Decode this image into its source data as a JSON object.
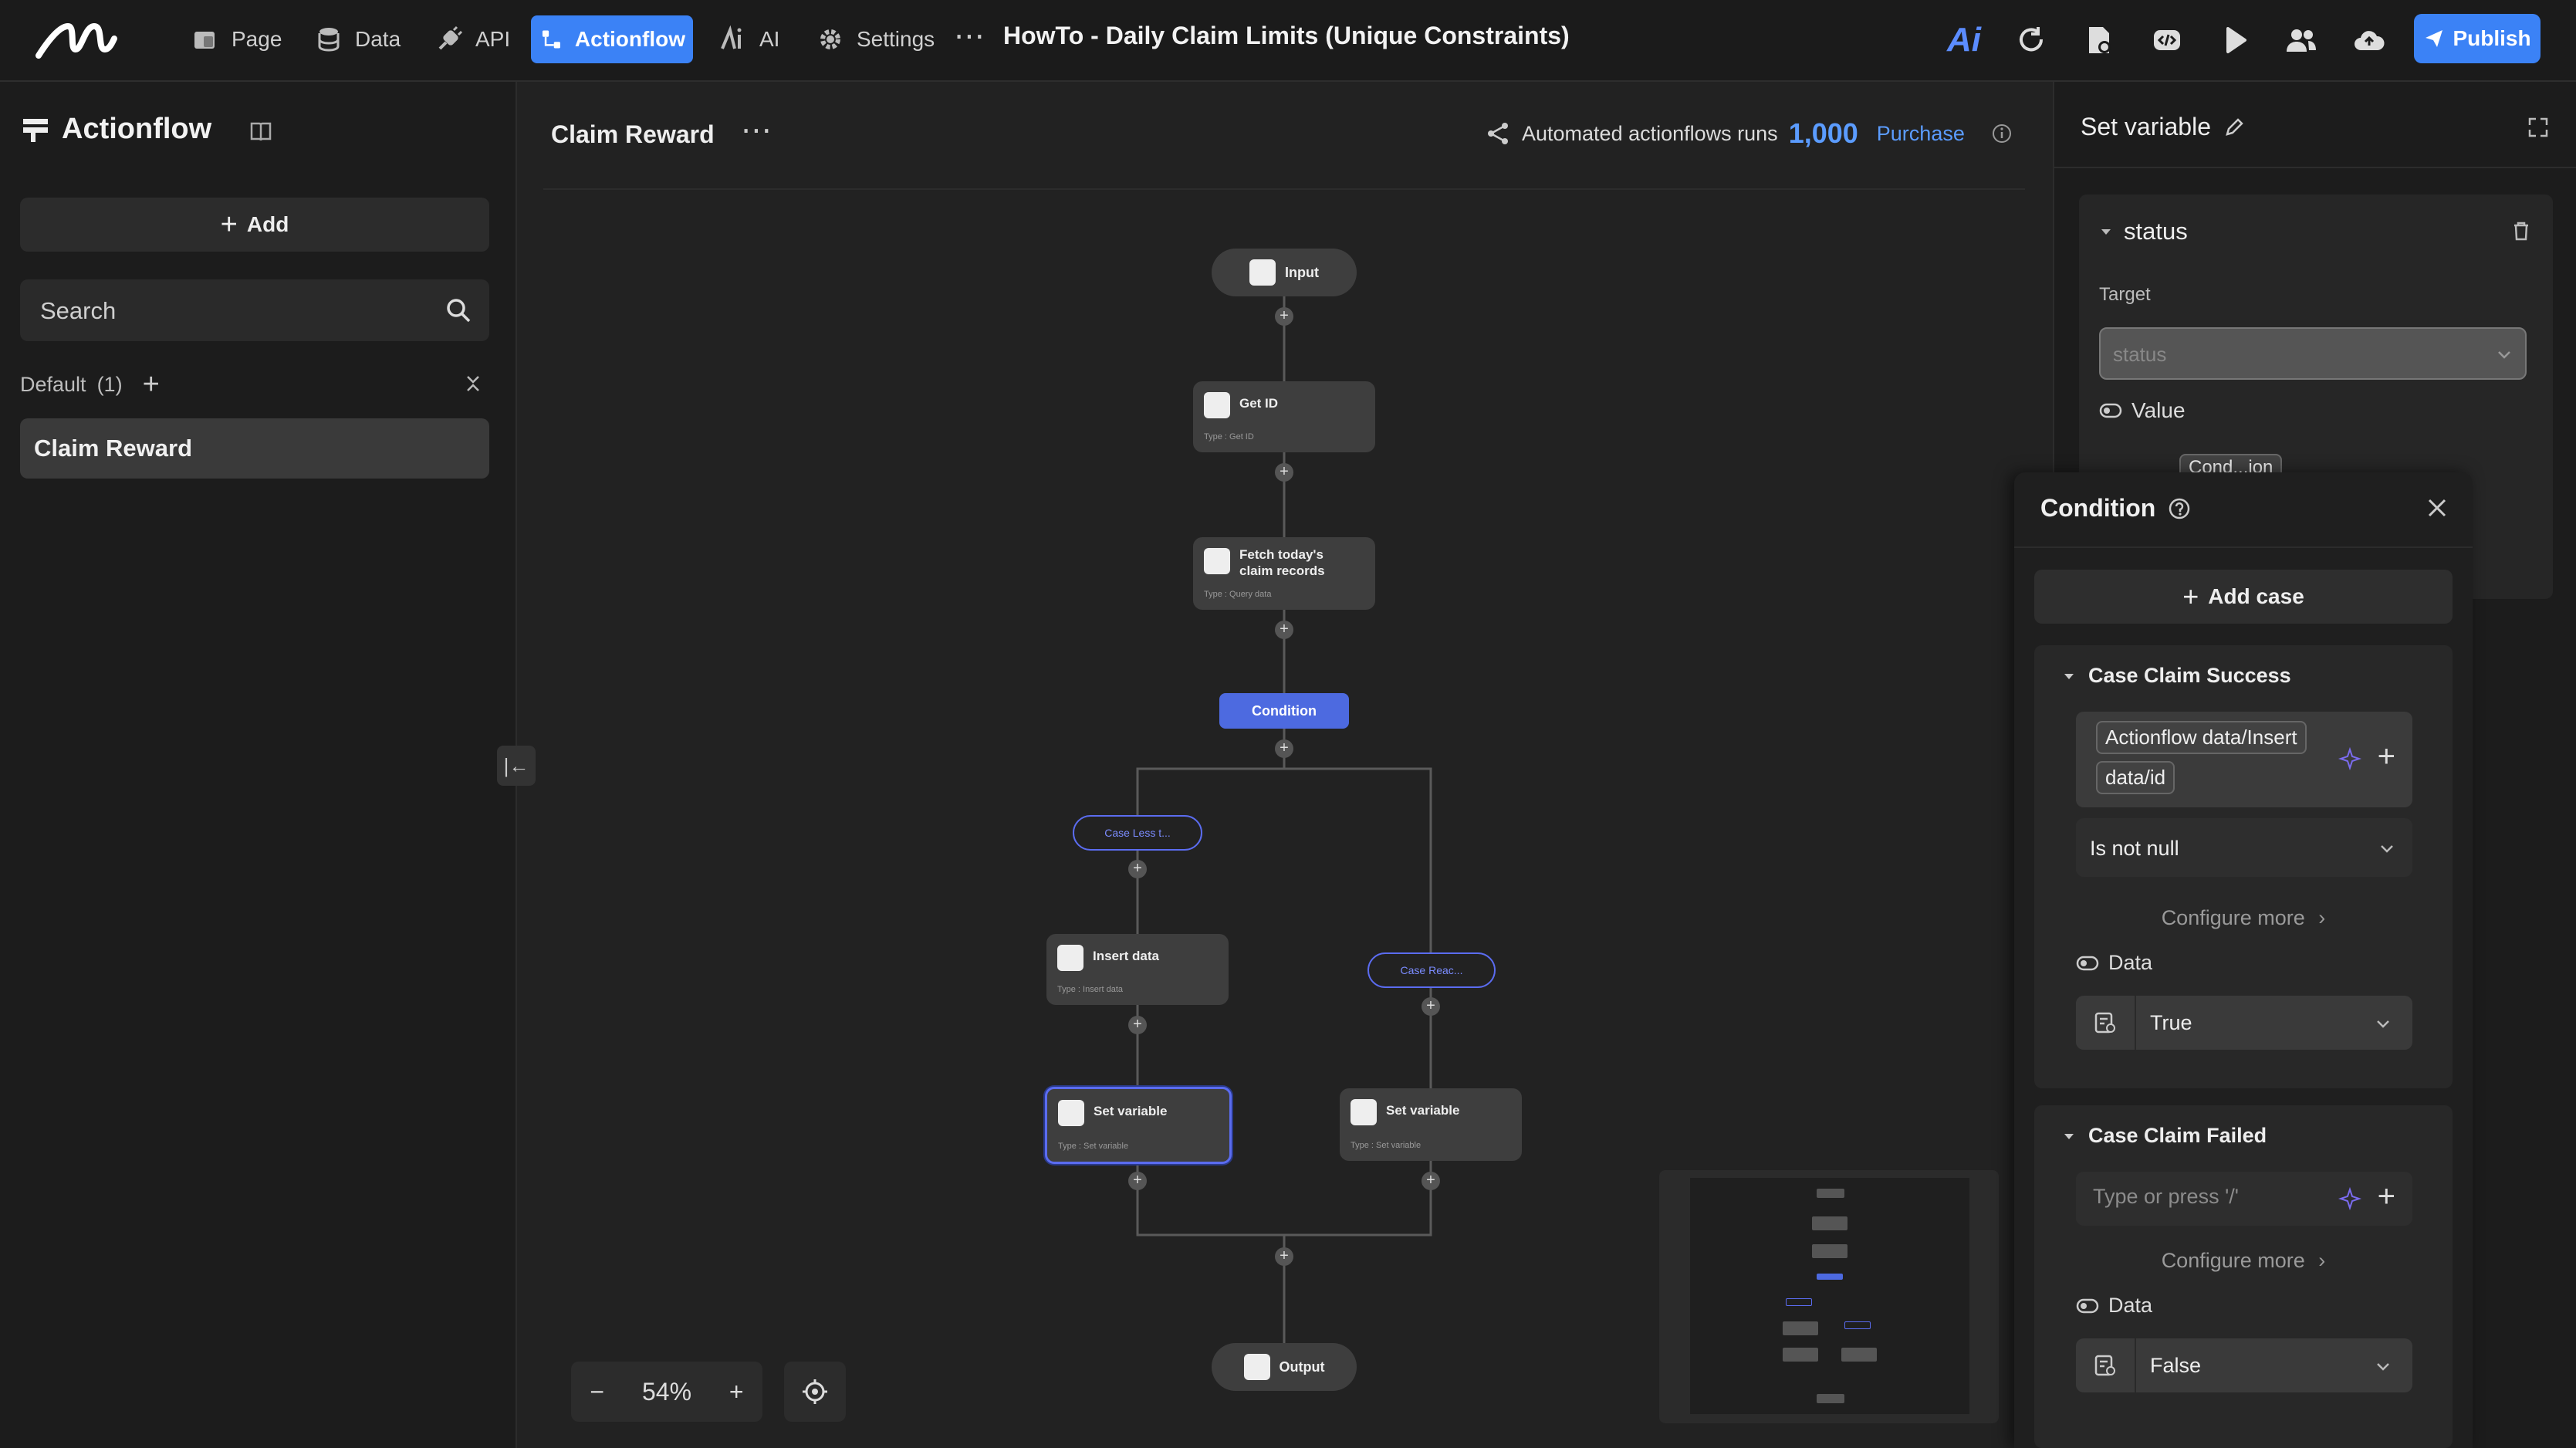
{
  "topbar": {
    "nav": [
      {
        "label": "Page",
        "icon": "page-icon"
      },
      {
        "label": "Data",
        "icon": "database-icon"
      },
      {
        "label": "API",
        "icon": "plug-icon"
      },
      {
        "label": "Actionflow",
        "icon": "actionflow-icon",
        "active": true
      },
      {
        "label": "AI",
        "icon": "ai-icon"
      },
      {
        "label": "Settings",
        "icon": "gear-icon"
      }
    ],
    "more": "⋯",
    "project_title": "HowTo - Daily Claim Limits (Unique Constraints)",
    "ai_logo_text": "Ai",
    "publish_label": "Publish"
  },
  "sidebar": {
    "title": "Actionflow",
    "add_label": "Add",
    "search_placeholder": "Search",
    "group_label": "Default",
    "group_count": "(1)",
    "items": [
      {
        "label": "Claim Reward",
        "selected": true
      }
    ]
  },
  "canvas": {
    "flow_name": "Claim Reward",
    "runs_text": "Automated actionflows runs",
    "runs_count": "1,000",
    "purchase_label": "Purchase",
    "zoom": "54%",
    "nodes": {
      "input": {
        "title": "Input"
      },
      "get_id": {
        "title": "Get ID",
        "type": "Type : Get ID"
      },
      "fetch": {
        "title_line1": "Fetch today's",
        "title_line2": "claim records",
        "type": "Type : Query data"
      },
      "condition": {
        "title": "Condition"
      },
      "case_left": {
        "title": "Case Less t..."
      },
      "case_right": {
        "title": "Case Reac..."
      },
      "insert": {
        "title": "Insert data",
        "type": "Type : Insert data"
      },
      "setvar_left": {
        "title": "Set variable",
        "type": "Type : Set variable"
      },
      "setvar_right": {
        "title": "Set variable",
        "type": "Type : Set variable"
      },
      "output": {
        "title": "Output"
      }
    }
  },
  "right_panel": {
    "title": "Set variable",
    "section_title": "status",
    "target_label": "Target",
    "target_value": "status",
    "value_label": "Value",
    "value_chip": "Cond...ion"
  },
  "condition_popup": {
    "title": "Condition",
    "add_case_label": "Add case",
    "cases": [
      {
        "title": "Case Claim Success",
        "expr_chip_line1": "Actionflow data/Insert",
        "expr_chip_line2": "data/id",
        "operator": "Is not null",
        "configure_more": "Configure more",
        "data_label": "Data",
        "data_value": "True"
      },
      {
        "title": "Case Claim Failed",
        "expr_placeholder": "Type or press '/'",
        "configure_more": "Configure more",
        "data_label": "Data",
        "data_value": "False"
      }
    ]
  },
  "colors": {
    "accent": "#3b82f6",
    "condition_node": "#4d6ae0",
    "case_outline": "#5b6cf0",
    "link": "#5b9cff"
  }
}
